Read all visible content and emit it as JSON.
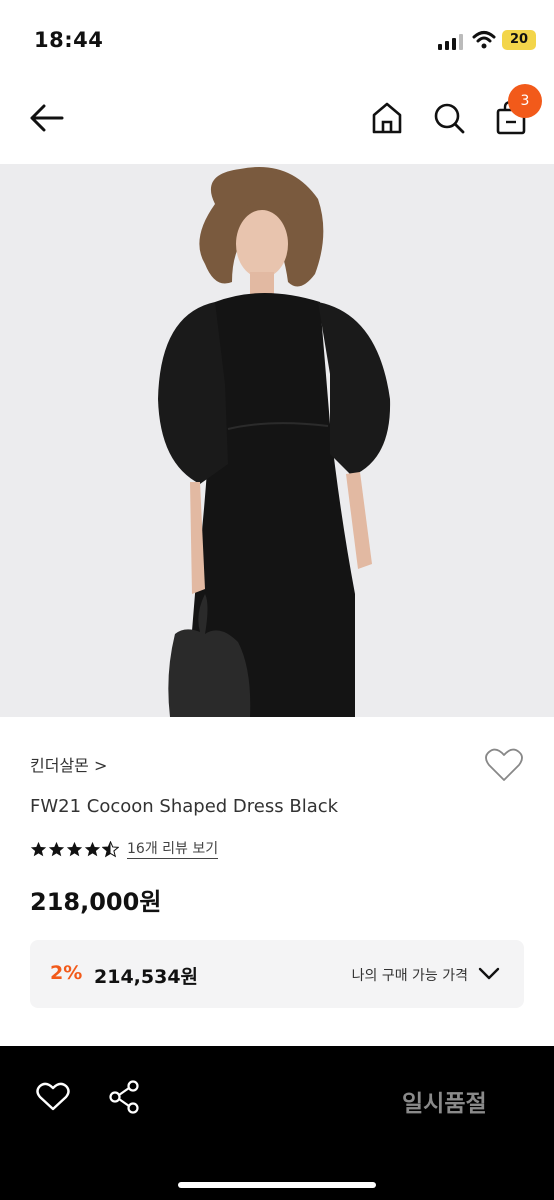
{
  "status_bar": {
    "time": "18:44",
    "battery": "20"
  },
  "nav": {
    "cart_count": "3"
  },
  "product": {
    "brand": "킨더살몬 >",
    "title": "FW21 Cocoon Shaped Dress Black",
    "rating": 4.5,
    "review_link": "16개 리뷰 보기",
    "price": "218,000원"
  },
  "my_price": {
    "discount": "2%",
    "price": "214,534원",
    "label": "나의 구매 가능 가격"
  },
  "bottom_bar": {
    "sold_out": "일시품절"
  },
  "colors": {
    "accent": "#f25a1a",
    "image_bg": "#ececee",
    "bottom_bar": "#000000"
  }
}
